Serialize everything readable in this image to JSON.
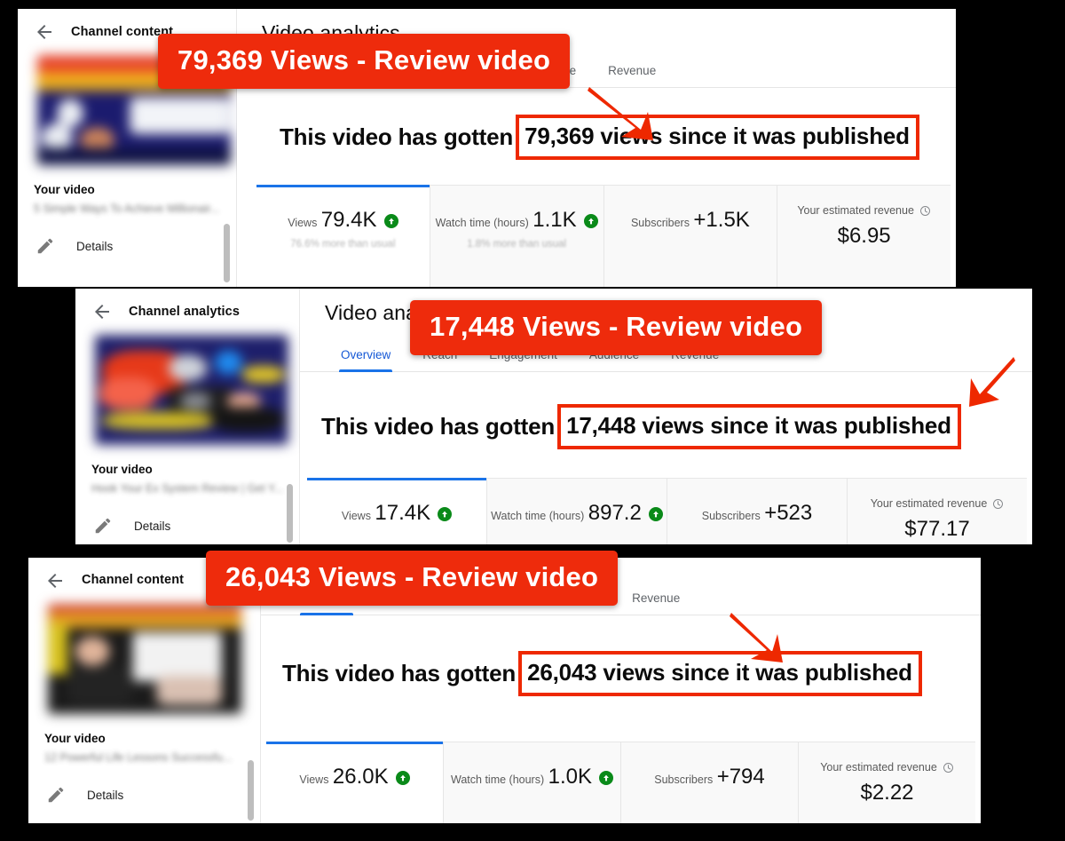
{
  "background_color": "#000000",
  "accent_red": "#ee2b0c",
  "accent_blue": "#1a73e8",
  "accent_green": "#0a8a19",
  "tabs": [
    "Overview",
    "Reach",
    "Engagement",
    "Audience",
    "Revenue"
  ],
  "common": {
    "main_title": "Video analytics",
    "your_video_label": "Your video",
    "details_label": "Details",
    "headline_prefix": "This video has gotten",
    "headline_suffix": "views since it was published",
    "metric_labels": {
      "views": "Views",
      "watch_time": "Watch time (hours)",
      "subscribers": "Subscribers",
      "revenue": "Your estimated revenue"
    },
    "icons": {
      "back": "back-arrow-icon",
      "pencil": "pencil-icon",
      "clock": "clock-icon",
      "up": "arrow-up-badge-icon"
    }
  },
  "panels": [
    {
      "id": "panel-1",
      "sidebar_title": "Channel content",
      "video_title": "5 Simple Ways To Achieve Millionair...",
      "main_title": "Video analytics",
      "active_tab": "Overview",
      "headline_prefix": "This video has gotten",
      "headline_boxed": "79,369 views since it was published",
      "banner": "79,369 Views - Review video",
      "metrics": [
        {
          "label": "Views",
          "value": "79.4K",
          "trend": "up",
          "sub": "76.6% more than usual"
        },
        {
          "label": "Watch time (hours)",
          "value": "1.1K",
          "trend": "up",
          "sub": "1.8% more than usual"
        },
        {
          "label": "Subscribers",
          "value": "+1.5K",
          "trend": "none",
          "sub": ""
        },
        {
          "label": "Your estimated revenue",
          "value": "$6.95",
          "trend": "none",
          "sub": "",
          "has_clock": true
        }
      ]
    },
    {
      "id": "panel-2",
      "sidebar_title": "Channel analytics",
      "video_title": "Hook Your Ex System Review | Get Y...",
      "main_title": "Video analytics",
      "active_tab": "Overview",
      "headline_prefix": "This video has gotten",
      "headline_boxed": "17,448 views since it was published",
      "banner": "17,448 Views - Review video",
      "metrics": [
        {
          "label": "Views",
          "value": "17.4K",
          "trend": "up",
          "sub": ""
        },
        {
          "label": "Watch time (hours)",
          "value": "897.2",
          "trend": "up",
          "sub": ""
        },
        {
          "label": "Subscribers",
          "value": "+523",
          "trend": "none",
          "sub": ""
        },
        {
          "label": "Your estimated revenue",
          "value": "$77.17",
          "trend": "none",
          "sub": "",
          "has_clock": true
        }
      ]
    },
    {
      "id": "panel-3",
      "sidebar_title": "Channel content",
      "video_title": "12 Powerful Life Lessons Successfu...",
      "main_title": "",
      "active_tab": "Overview",
      "headline_prefix": "This video has gotten",
      "headline_boxed": "26,043 views since it was published",
      "banner": "26,043 Views - Review video",
      "metrics": [
        {
          "label": "Views",
          "value": "26.0K",
          "trend": "up",
          "sub": ""
        },
        {
          "label": "Watch time (hours)",
          "value": "1.0K",
          "trend": "up",
          "sub": ""
        },
        {
          "label": "Subscribers",
          "value": "+794",
          "trend": "none",
          "sub": ""
        },
        {
          "label": "Your estimated revenue",
          "value": "$2.22",
          "trend": "none",
          "sub": "",
          "has_clock": true
        }
      ]
    }
  ]
}
